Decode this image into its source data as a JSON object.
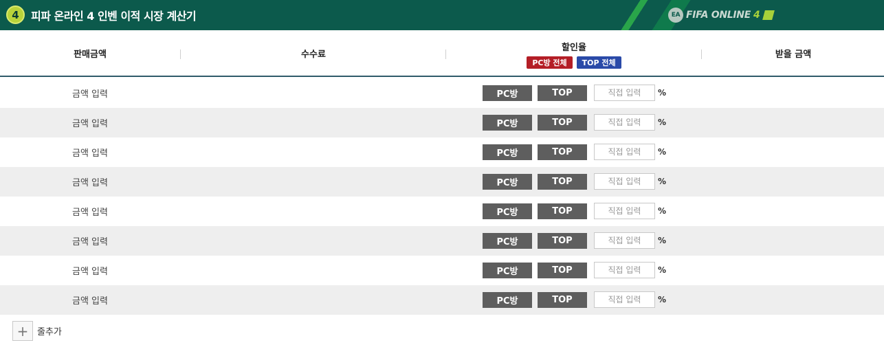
{
  "titlebar": {
    "badge": "4",
    "title": "피파 온라인 4 인벤 이적 시장 계산기",
    "logo_text": "FIFA ONLINE",
    "logo_num": "4",
    "logo_ea": "EA"
  },
  "header": {
    "col_sale": "판매금액",
    "col_fee": "수수료",
    "col_discount": "할인율",
    "btn_pc_all": "PC방 전체",
    "btn_top_all": "TOP 전체",
    "col_receive": "받을 금액"
  },
  "colors": {
    "title_bg": "#0c5a4c",
    "pc_all_red": "#b41e26",
    "top_all_blue": "#2a4aa8",
    "discount_btn": "#5e5e5e"
  },
  "rows": [
    {
      "amount": "금액 입력",
      "pc": "PC방",
      "top": "TOP",
      "direct_placeholder": "직접 입력",
      "pct": "%"
    },
    {
      "amount": "금액 입력",
      "pc": "PC방",
      "top": "TOP",
      "direct_placeholder": "직접 입력",
      "pct": "%"
    },
    {
      "amount": "금액 입력",
      "pc": "PC방",
      "top": "TOP",
      "direct_placeholder": "직접 입력",
      "pct": "%"
    },
    {
      "amount": "금액 입력",
      "pc": "PC방",
      "top": "TOP",
      "direct_placeholder": "직접 입력",
      "pct": "%"
    },
    {
      "amount": "금액 입력",
      "pc": "PC방",
      "top": "TOP",
      "direct_placeholder": "직접 입력",
      "pct": "%"
    },
    {
      "amount": "금액 입력",
      "pc": "PC방",
      "top": "TOP",
      "direct_placeholder": "직접 입력",
      "pct": "%"
    },
    {
      "amount": "금액 입력",
      "pc": "PC방",
      "top": "TOP",
      "direct_placeholder": "직접 입력",
      "pct": "%"
    },
    {
      "amount": "금액 입력",
      "pc": "PC방",
      "top": "TOP",
      "direct_placeholder": "직접 입력",
      "pct": "%"
    }
  ],
  "add_row": {
    "icon": "plus-icon",
    "label": "줄추가"
  }
}
